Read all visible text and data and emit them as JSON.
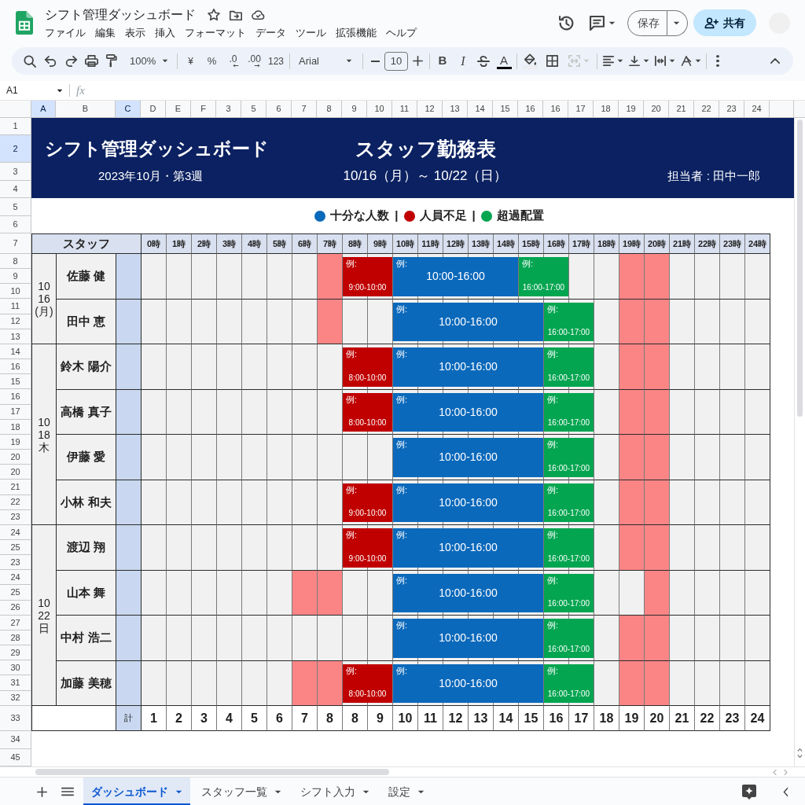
{
  "document": {
    "title": "シフト管理ダッシュボード",
    "menu": [
      "ファイル",
      "編集",
      "表示",
      "挿入",
      "フォーマット",
      "データ",
      "ツール",
      "拡張機能",
      "ヘルプ"
    ]
  },
  "actions": {
    "save": "保存",
    "share": "共有"
  },
  "toolbar": {
    "zoom": "100%",
    "currency": "¥",
    "percent": "%",
    "decimal_decrease": ".0",
    "decimal_increase": ".00",
    "number_format": "123",
    "font": "Arial",
    "font_size": "10",
    "bold": "B",
    "italic": "I",
    "text_color": "A",
    "merge": {
      "disabled": true
    }
  },
  "formula_bar": {
    "cell": "A1",
    "function_label": "fx"
  },
  "column_headers": [
    {
      "label": "A",
      "selected": true
    },
    {
      "label": "B",
      "selected": false
    },
    {
      "label": "C",
      "selected": true
    },
    {
      "label": "D",
      "selected": false
    },
    {
      "label": "E",
      "selected": false
    },
    {
      "label": "F",
      "selected": false
    },
    {
      "label": "3",
      "selected": false
    },
    {
      "label": "5",
      "selected": false
    },
    {
      "label": "6",
      "selected": false
    },
    {
      "label": "7",
      "selected": false
    },
    {
      "label": "8",
      "selected": false
    },
    {
      "label": "9",
      "selected": false
    },
    {
      "label": "10",
      "selected": false
    },
    {
      "label": "11",
      "selected": false
    },
    {
      "label": "12",
      "selected": false
    },
    {
      "label": "13",
      "selected": false
    },
    {
      "label": "14",
      "selected": false
    },
    {
      "label": "15",
      "selected": false
    },
    {
      "label": "16",
      "selected": false
    },
    {
      "label": "16",
      "selected": false
    },
    {
      "label": "17",
      "selected": false
    },
    {
      "label": "18",
      "selected": false
    },
    {
      "label": "19",
      "selected": false
    },
    {
      "label": "20",
      "selected": false
    },
    {
      "label": "21",
      "selected": false
    },
    {
      "label": "22",
      "selected": false
    },
    {
      "label": "23",
      "selected": false
    },
    {
      "label": "24",
      "selected": false
    }
  ],
  "row_headers": [
    {
      "label": "1",
      "selected": false
    },
    {
      "label": "2",
      "selected": true
    },
    {
      "label": "3",
      "selected": false
    },
    {
      "label": "4",
      "selected": false
    },
    {
      "label": "5",
      "selected": false
    },
    {
      "label": "6",
      "selected": false
    },
    {
      "label": "7",
      "selected": false
    },
    {
      "label": "8",
      "selected": false
    },
    {
      "label": "9",
      "selected": false
    },
    {
      "label": "10",
      "selected": false
    },
    {
      "label": "11",
      "selected": false
    },
    {
      "label": "12",
      "selected": false
    },
    {
      "label": "13",
      "selected": false
    },
    {
      "label": "14",
      "selected": false
    },
    {
      "label": "16",
      "selected": false
    },
    {
      "label": "15",
      "selected": false
    },
    {
      "label": "16",
      "selected": false
    },
    {
      "label": "17",
      "selected": false
    },
    {
      "label": "18",
      "selected": false
    },
    {
      "label": "19",
      "selected": false
    },
    {
      "label": "20",
      "selected": false
    },
    {
      "label": "20",
      "selected": false
    },
    {
      "label": "21",
      "selected": false
    },
    {
      "label": "22",
      "selected": false
    },
    {
      "label": "23",
      "selected": false
    },
    {
      "label": "24",
      "selected": false
    },
    {
      "label": "25",
      "selected": false
    },
    {
      "label": "23",
      "selected": false
    },
    {
      "label": "24",
      "selected": false
    },
    {
      "label": "25",
      "selected": false
    },
    {
      "label": "26",
      "selected": false
    },
    {
      "label": "27",
      "selected": false
    },
    {
      "label": "28",
      "selected": false
    },
    {
      "label": "29",
      "selected": false
    },
    {
      "label": "30",
      "selected": false
    },
    {
      "label": "31",
      "selected": false
    },
    {
      "label": "32",
      "selected": false
    },
    {
      "label": "33",
      "selected": false
    },
    {
      "label": "34",
      "selected": false
    },
    {
      "label": "45",
      "selected": false
    }
  ],
  "banner": {
    "title": "シフト管理ダッシュボード",
    "heading": "スタッフ勤務表",
    "subtitle": "2023年10月・第3週",
    "period": "10/16（月）～ 10/22（日）",
    "owner": "担当者 : 田中一郎"
  },
  "legend": {
    "separator": "|",
    "items": [
      {
        "label": "十分な人数",
        "color": "#0b69bb"
      },
      {
        "label": "人員不足",
        "color": "#c00000"
      },
      {
        "label": "超過配置",
        "color": "#03a550"
      }
    ]
  },
  "schedule": {
    "staff_header": "スタッフ",
    "hours": [
      "0時",
      "1時",
      "2時",
      "3時",
      "4時",
      "5時",
      "6時",
      "7時",
      "8時",
      "9時",
      "10時",
      "11時",
      "12時",
      "13時",
      "14時",
      "15時",
      "16時",
      "17時",
      "18時",
      "19時",
      "20時",
      "21時",
      "22時",
      "23時",
      "24時"
    ],
    "groups": [
      {
        "date_lines": [
          "10",
          "16",
          "(月)"
        ],
        "staff": [
          {
            "name": "佐藤 健",
            "cells": [
              {
                "kind": "blank"
              },
              {
                "kind": "blank"
              },
              {
                "kind": "blank"
              },
              {
                "kind": "blank"
              },
              {
                "kind": "blank"
              },
              {
                "kind": "blank"
              },
              {
                "kind": "blank"
              },
              {
                "kind": "warning"
              },
              {
                "kind": "short"
              },
              {
                "kind": "short"
              },
              {
                "kind": "enough"
              },
              {
                "kind": "enough"
              },
              {
                "kind": "enough"
              },
              {
                "kind": "enough"
              },
              {
                "kind": "enough"
              },
              {
                "kind": "over"
              },
              {
                "kind": "over"
              },
              {
                "kind": "blank"
              },
              {
                "kind": "blank"
              },
              {
                "kind": "warning"
              },
              {
                "kind": "warning"
              },
              {
                "kind": "blank"
              },
              {
                "kind": "blank"
              },
              {
                "kind": "blank"
              },
              {
                "kind": "blank"
              }
            ],
            "shifts": [
              {
                "label": "例:",
                "time": "9:00-10:00"
              },
              {
                "label": "例:",
                "time": "10:00-16:00"
              },
              {
                "label": "例:",
                "time": "16:00-17:00"
              }
            ]
          },
          {
            "name": "田中 恵",
            "cells": [
              {
                "kind": "blank"
              },
              {
                "kind": "blank"
              },
              {
                "kind": "blank"
              },
              {
                "kind": "blank"
              },
              {
                "kind": "blank"
              },
              {
                "kind": "blank"
              },
              {
                "kind": "blank"
              },
              {
                "kind": "warning"
              },
              {
                "kind": "blank"
              },
              {
                "kind": "blank"
              },
              {
                "kind": "enough"
              },
              {
                "kind": "enough"
              },
              {
                "kind": "enough"
              },
              {
                "kind": "enough"
              },
              {
                "kind": "enough"
              },
              {
                "kind": "enough"
              },
              {
                "kind": "over"
              },
              {
                "kind": "over"
              },
              {
                "kind": "blank"
              },
              {
                "kind": "warning"
              },
              {
                "kind": "warning"
              },
              {
                "kind": "blank"
              },
              {
                "kind": "blank"
              },
              {
                "kind": "blank"
              },
              {
                "kind": "blank"
              }
            ],
            "shifts": [
              {
                "label": "例:",
                "time": "10:00-16:00"
              },
              {
                "label": "例:",
                "time": "16:00-17:00"
              }
            ]
          }
        ]
      },
      {
        "date_lines": [
          "10",
          "18",
          "木"
        ],
        "staff": [
          {
            "name": "鈴木 陽介",
            "cells": [
              {
                "kind": "blank"
              },
              {
                "kind": "blank"
              },
              {
                "kind": "blank"
              },
              {
                "kind": "blank"
              },
              {
                "kind": "blank"
              },
              {
                "kind": "blank"
              },
              {
                "kind": "blank"
              },
              {
                "kind": "blank"
              },
              {
                "kind": "short"
              },
              {
                "kind": "short"
              },
              {
                "kind": "enough"
              },
              {
                "kind": "enough"
              },
              {
                "kind": "enough"
              },
              {
                "kind": "enough"
              },
              {
                "kind": "enough"
              },
              {
                "kind": "enough"
              },
              {
                "kind": "over"
              },
              {
                "kind": "over"
              },
              {
                "kind": "blank"
              },
              {
                "kind": "warning"
              },
              {
                "kind": "warning"
              },
              {
                "kind": "blank"
              },
              {
                "kind": "blank"
              },
              {
                "kind": "blank"
              },
              {
                "kind": "blank"
              }
            ],
            "shifts": [
              {
                "label": "例:",
                "time": "8:00-10:00"
              },
              {
                "label": "例:",
                "time": "10:00-16:00"
              },
              {
                "label": "例:",
                "time": "16:00-17:00"
              }
            ]
          },
          {
            "name": "高橋 真子",
            "cells": [
              {
                "kind": "blank"
              },
              {
                "kind": "blank"
              },
              {
                "kind": "blank"
              },
              {
                "kind": "blank"
              },
              {
                "kind": "blank"
              },
              {
                "kind": "blank"
              },
              {
                "kind": "blank"
              },
              {
                "kind": "blank"
              },
              {
                "kind": "short"
              },
              {
                "kind": "short"
              },
              {
                "kind": "enough"
              },
              {
                "kind": "enough"
              },
              {
                "kind": "enough"
              },
              {
                "kind": "enough"
              },
              {
                "kind": "enough"
              },
              {
                "kind": "enough"
              },
              {
                "kind": "over"
              },
              {
                "kind": "over"
              },
              {
                "kind": "blank"
              },
              {
                "kind": "warning"
              },
              {
                "kind": "warning"
              },
              {
                "kind": "blank"
              },
              {
                "kind": "blank"
              },
              {
                "kind": "blank"
              },
              {
                "kind": "blank"
              }
            ],
            "shifts": [
              {
                "label": "例:",
                "time": "8:00-10:00"
              },
              {
                "label": "例:",
                "time": "10:00-16:00"
              },
              {
                "label": "例:",
                "time": "16:00-17:00"
              }
            ]
          },
          {
            "name": "伊藤 愛",
            "cells": [
              {
                "kind": "blank"
              },
              {
                "kind": "blank"
              },
              {
                "kind": "blank"
              },
              {
                "kind": "blank"
              },
              {
                "kind": "blank"
              },
              {
                "kind": "blank"
              },
              {
                "kind": "blank"
              },
              {
                "kind": "blank"
              },
              {
                "kind": "blank"
              },
              {
                "kind": "blank"
              },
              {
                "kind": "enough"
              },
              {
                "kind": "enough"
              },
              {
                "kind": "enough"
              },
              {
                "kind": "enough"
              },
              {
                "kind": "enough"
              },
              {
                "kind": "enough"
              },
              {
                "kind": "over"
              },
              {
                "kind": "over"
              },
              {
                "kind": "blank"
              },
              {
                "kind": "warning"
              },
              {
                "kind": "warning"
              },
              {
                "kind": "blank"
              },
              {
                "kind": "blank"
              },
              {
                "kind": "blank"
              },
              {
                "kind": "blank"
              }
            ],
            "shifts": [
              {
                "label": "例:",
                "time": "10:00-16:00"
              },
              {
                "label": "例:",
                "time": "16:00-17:00"
              }
            ]
          },
          {
            "name": "小林 和夫",
            "cells": [
              {
                "kind": "blank"
              },
              {
                "kind": "blank"
              },
              {
                "kind": "blank"
              },
              {
                "kind": "blank"
              },
              {
                "kind": "blank"
              },
              {
                "kind": "blank"
              },
              {
                "kind": "blank"
              },
              {
                "kind": "blank"
              },
              {
                "kind": "short"
              },
              {
                "kind": "short"
              },
              {
                "kind": "enough"
              },
              {
                "kind": "enough"
              },
              {
                "kind": "enough"
              },
              {
                "kind": "enough"
              },
              {
                "kind": "enough"
              },
              {
                "kind": "enough"
              },
              {
                "kind": "over"
              },
              {
                "kind": "over"
              },
              {
                "kind": "blank"
              },
              {
                "kind": "warning"
              },
              {
                "kind": "warning"
              },
              {
                "kind": "blank"
              },
              {
                "kind": "blank"
              },
              {
                "kind": "blank"
              },
              {
                "kind": "blank"
              }
            ],
            "shifts": [
              {
                "label": "例:",
                "time": "9:00-10:00"
              },
              {
                "label": "例:",
                "time": "10:00-16:00"
              },
              {
                "label": "例:",
                "time": "16:00-17:00"
              }
            ]
          }
        ]
      },
      {
        "date_lines": [
          "10",
          "22",
          "日"
        ],
        "staff": [
          {
            "name": "渡辺 翔",
            "cells": [
              {
                "kind": "blank"
              },
              {
                "kind": "blank"
              },
              {
                "kind": "blank"
              },
              {
                "kind": "blank"
              },
              {
                "kind": "blank"
              },
              {
                "kind": "blank"
              },
              {
                "kind": "blank"
              },
              {
                "kind": "blank"
              },
              {
                "kind": "short"
              },
              {
                "kind": "short"
              },
              {
                "kind": "enough"
              },
              {
                "kind": "enough"
              },
              {
                "kind": "enough"
              },
              {
                "kind": "enough"
              },
              {
                "kind": "enough"
              },
              {
                "kind": "enough"
              },
              {
                "kind": "over"
              },
              {
                "kind": "over"
              },
              {
                "kind": "blank"
              },
              {
                "kind": "warning"
              },
              {
                "kind": "warning"
              },
              {
                "kind": "blank"
              },
              {
                "kind": "blank"
              },
              {
                "kind": "blank"
              },
              {
                "kind": "blank"
              }
            ],
            "shifts": [
              {
                "label": "例:",
                "time": "9:00-10:00"
              },
              {
                "label": "例:",
                "time": "10:00-16:00"
              },
              {
                "label": "例:",
                "time": "16:00-17:00"
              }
            ]
          },
          {
            "name": "山本 舞",
            "cells": [
              {
                "kind": "blank"
              },
              {
                "kind": "blank"
              },
              {
                "kind": "blank"
              },
              {
                "kind": "blank"
              },
              {
                "kind": "blank"
              },
              {
                "kind": "blank"
              },
              {
                "kind": "warning"
              },
              {
                "kind": "warning"
              },
              {
                "kind": "blank"
              },
              {
                "kind": "blank"
              },
              {
                "kind": "enough"
              },
              {
                "kind": "enough"
              },
              {
                "kind": "enough"
              },
              {
                "kind": "enough"
              },
              {
                "kind": "enough"
              },
              {
                "kind": "enough"
              },
              {
                "kind": "over"
              },
              {
                "kind": "over"
              },
              {
                "kind": "blank"
              },
              {
                "kind": "blank"
              },
              {
                "kind": "warning"
              },
              {
                "kind": "blank"
              },
              {
                "kind": "blank"
              },
              {
                "kind": "blank"
              },
              {
                "kind": "blank"
              }
            ],
            "shifts": [
              {
                "label": "例:",
                "time": "10:00-16:00"
              },
              {
                "label": "例:",
                "time": "16:00-17:00"
              }
            ]
          },
          {
            "name": "中村 浩二",
            "cells": [
              {
                "kind": "blank"
              },
              {
                "kind": "blank"
              },
              {
                "kind": "blank"
              },
              {
                "kind": "blank"
              },
              {
                "kind": "blank"
              },
              {
                "kind": "blank"
              },
              {
                "kind": "blank"
              },
              {
                "kind": "blank"
              },
              {
                "kind": "blank"
              },
              {
                "kind": "blank"
              },
              {
                "kind": "enough"
              },
              {
                "kind": "enough"
              },
              {
                "kind": "enough"
              },
              {
                "kind": "enough"
              },
              {
                "kind": "enough"
              },
              {
                "kind": "enough"
              },
              {
                "kind": "over"
              },
              {
                "kind": "over"
              },
              {
                "kind": "blank"
              },
              {
                "kind": "warning"
              },
              {
                "kind": "warning"
              },
              {
                "kind": "blank"
              },
              {
                "kind": "blank"
              },
              {
                "kind": "blank"
              },
              {
                "kind": "blank"
              }
            ],
            "shifts": [
              {
                "label": "例:",
                "time": "10:00-16:00"
              },
              {
                "label": "例:",
                "time": "16:00-17:00"
              }
            ]
          },
          {
            "name": "加藤 美穂",
            "cells": [
              {
                "kind": "blank"
              },
              {
                "kind": "blank"
              },
              {
                "kind": "blank"
              },
              {
                "kind": "blank"
              },
              {
                "kind": "blank"
              },
              {
                "kind": "blank"
              },
              {
                "kind": "warning"
              },
              {
                "kind": "warning"
              },
              {
                "kind": "short"
              },
              {
                "kind": "short"
              },
              {
                "kind": "enough"
              },
              {
                "kind": "enough"
              },
              {
                "kind": "enough"
              },
              {
                "kind": "enough"
              },
              {
                "kind": "enough"
              },
              {
                "kind": "enough"
              },
              {
                "kind": "over"
              },
              {
                "kind": "over"
              },
              {
                "kind": "blank"
              },
              {
                "kind": "warning"
              },
              {
                "kind": "warning"
              },
              {
                "kind": "blank"
              },
              {
                "kind": "blank"
              },
              {
                "kind": "blank"
              },
              {
                "kind": "blank"
              }
            ],
            "shifts": [
              {
                "label": "例:",
                "time": "8:00-10:00"
              },
              {
                "label": "例:",
                "time": "10:00-16:00"
              },
              {
                "label": "例:",
                "time": "16:00-17:00"
              }
            ]
          }
        ]
      }
    ],
    "total_label": "計",
    "totals": [
      "1",
      "2",
      "3",
      "4",
      "5",
      "6",
      "7",
      "8",
      "8",
      "9",
      "10",
      "11",
      "12",
      "13",
      "14",
      "15",
      "16",
      "17",
      "18",
      "19",
      "20",
      "21",
      "22",
      "23",
      "24"
    ]
  },
  "sheet_tabs": [
    {
      "label": "ダッシュボード",
      "selected": true
    },
    {
      "label": "スタッフ一覧",
      "selected": false
    },
    {
      "label": "シフト入力",
      "selected": false
    },
    {
      "label": "設定",
      "selected": false
    }
  ]
}
